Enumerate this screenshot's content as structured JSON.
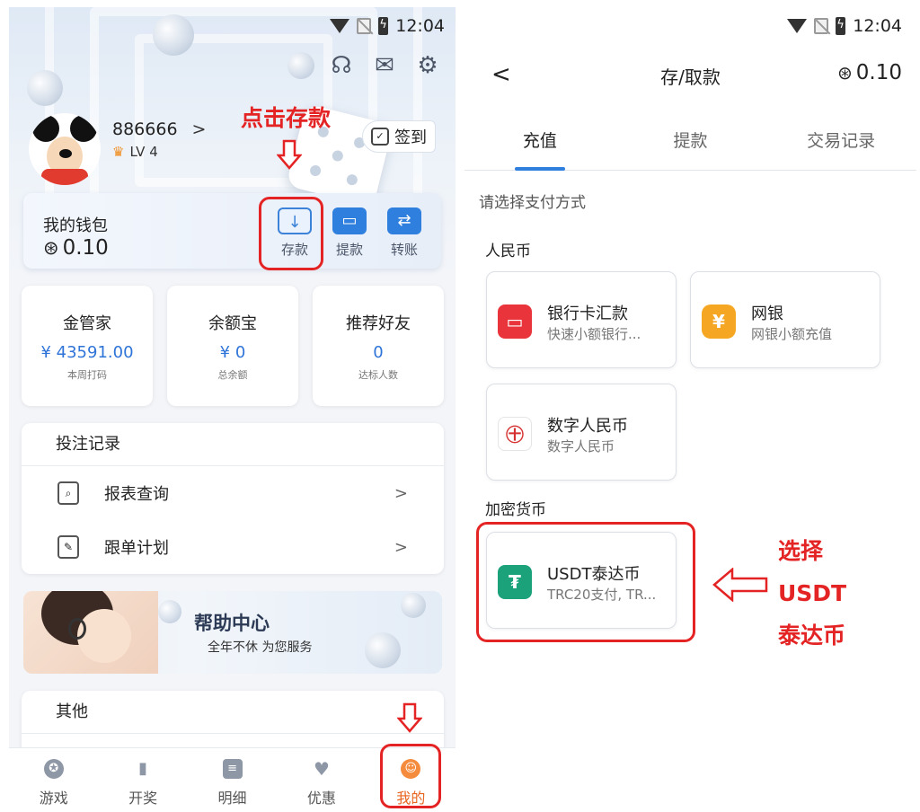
{
  "statusbar": {
    "time": "12:04"
  },
  "left": {
    "user": {
      "name": "886666",
      "chevron": ">",
      "level": "LV 4"
    },
    "checkin_label": "签到",
    "wallet": {
      "title": "我的钱包",
      "balance": "0.10",
      "buttons": [
        {
          "label": "存款",
          "icon": "deposit-icon"
        },
        {
          "label": "提款",
          "icon": "card-icon"
        },
        {
          "label": "转账",
          "icon": "transfer-icon"
        }
      ]
    },
    "stats": [
      {
        "title": "金管家",
        "value": "¥ 43591.00",
        "sub": "本周打码"
      },
      {
        "title": "余额宝",
        "value": "¥ 0",
        "sub": "总余额"
      },
      {
        "title": "推荐好友",
        "value": "0",
        "sub": "达标人数"
      }
    ],
    "records": {
      "title": "投注记录",
      "rows": [
        {
          "label": "报表查询",
          "icon": "report-search-icon"
        },
        {
          "label": "跟单计划",
          "icon": "follow-plan-icon"
        }
      ],
      "chevron": ">"
    },
    "help": {
      "title": "帮助中心",
      "subtitle": "全年不休 为您服务"
    },
    "other": {
      "title": "其他"
    },
    "tabs": [
      {
        "label": "游戏",
        "icon": "game-icon"
      },
      {
        "label": "开奖",
        "icon": "chart-icon"
      },
      {
        "label": "明细",
        "icon": "detail-icon"
      },
      {
        "label": "优惠",
        "icon": "heart-icon"
      },
      {
        "label": "我的",
        "icon": "user-icon",
        "active": true
      }
    ],
    "annotation": "点击存款"
  },
  "right": {
    "back": "<",
    "title": "存/取款",
    "balance": "0.10",
    "tabs": [
      "充值",
      "提款",
      "交易记录"
    ],
    "prompt": "请选择支付方式",
    "section_rmb": "人民币",
    "section_crypto": "加密货币",
    "methods": [
      {
        "title": "银行卡汇款",
        "sub": "快速小额银行...",
        "icon": "bank-card-icon",
        "color": "#e8343a"
      },
      {
        "title": "网银",
        "sub": "网银小额充值",
        "icon": "yen-coin-icon",
        "color": "#f5a623"
      },
      {
        "title": "数字人民币",
        "sub": "数字人民币",
        "icon": "digital-rmb-icon",
        "color": "#ffffff"
      }
    ],
    "crypto": {
      "title": "USDT泰达币",
      "sub": "TRC20支付, TR...",
      "icon": "tether-icon",
      "color": "#1ba27a"
    },
    "annotation": [
      "选择",
      "USDT",
      "泰达币"
    ]
  },
  "colors": {
    "accent": "#2f7fde",
    "annotation": "#e42424",
    "active_tab": "#f48b3d"
  }
}
